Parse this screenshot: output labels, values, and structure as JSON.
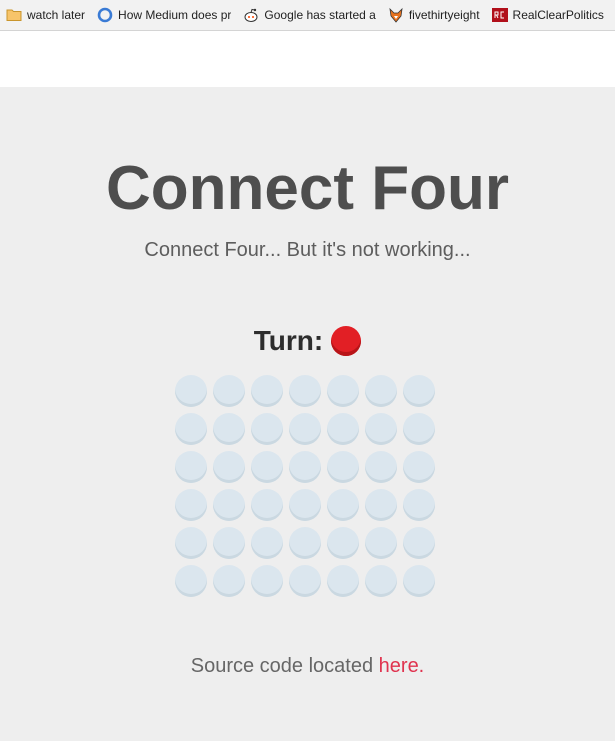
{
  "bookmarks": [
    {
      "label": "watch later",
      "icon": "folder-icon"
    },
    {
      "label": "How Medium does pr",
      "icon": "blue-ring-icon"
    },
    {
      "label": "Google has started a",
      "icon": "reddit-icon"
    },
    {
      "label": "fivethirtyeight",
      "icon": "fox-icon"
    },
    {
      "label": "RealClearPolitics",
      "icon": "rcp-icon"
    }
  ],
  "page": {
    "title": "Connect Four",
    "subtitle": "Connect Four... But it's not working...",
    "turn_label": "Turn:",
    "turn_color": "#e21f25",
    "source_text": "Source code located",
    "source_link": "here."
  },
  "board": {
    "rows": 6,
    "cols": 7,
    "state": "empty"
  }
}
